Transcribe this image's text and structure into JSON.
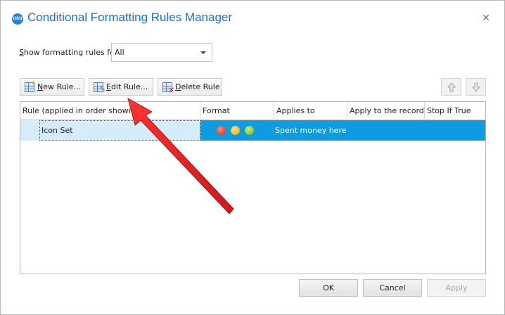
{
  "window": {
    "title": "Conditional Formatting Rules Manager",
    "app_icon_text": "USU"
  },
  "filter": {
    "label_prefix": "S",
    "label_rest": "how formatting rules for:",
    "selected": "All"
  },
  "toolbar": {
    "new_rule_u": "N",
    "new_rule_rest": "ew Rule...",
    "edit_rule_u": "E",
    "edit_rule_rest": "dit Rule...",
    "delete_rule_u": "D",
    "delete_rule_rest": "elete Rule"
  },
  "grid": {
    "columns": [
      "Rule (applied in order shown)",
      "Format",
      "Applies to",
      "Apply to the record",
      "Stop If True"
    ],
    "rows": [
      {
        "rule": "Icon Set",
        "format_icons": [
          "red-circle-icon",
          "yellow-circle-icon",
          "green-circle-icon"
        ],
        "applies_to": "Spent money here",
        "apply_to_record": "",
        "stop_if_true": ""
      }
    ]
  },
  "footer": {
    "ok": "OK",
    "cancel": "Cancel",
    "apply": "Apply"
  },
  "colors": {
    "title_blue": "#1f6fc5",
    "selection_blue": "#0f9bdf",
    "annotation_red": "#e8161a"
  }
}
